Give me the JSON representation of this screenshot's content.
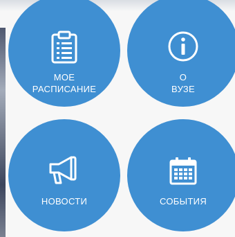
{
  "tiles": [
    {
      "id": "schedule",
      "line1": "МОЕ",
      "line2": "РАСПИСАНИЕ",
      "icon": "clipboard-list-icon"
    },
    {
      "id": "about",
      "line1": "О",
      "line2": "ВУЗЕ",
      "icon": "info-circle-icon"
    },
    {
      "id": "news",
      "line1": "НОВОСТИ",
      "line2": "",
      "icon": "megaphone-icon"
    },
    {
      "id": "events",
      "line1": "СОБЫТИЯ",
      "line2": "",
      "icon": "calendar-icon"
    }
  ],
  "colors": {
    "tile": "#3f8fd2",
    "text": "#ffffff",
    "background": "#f7f7f7"
  }
}
